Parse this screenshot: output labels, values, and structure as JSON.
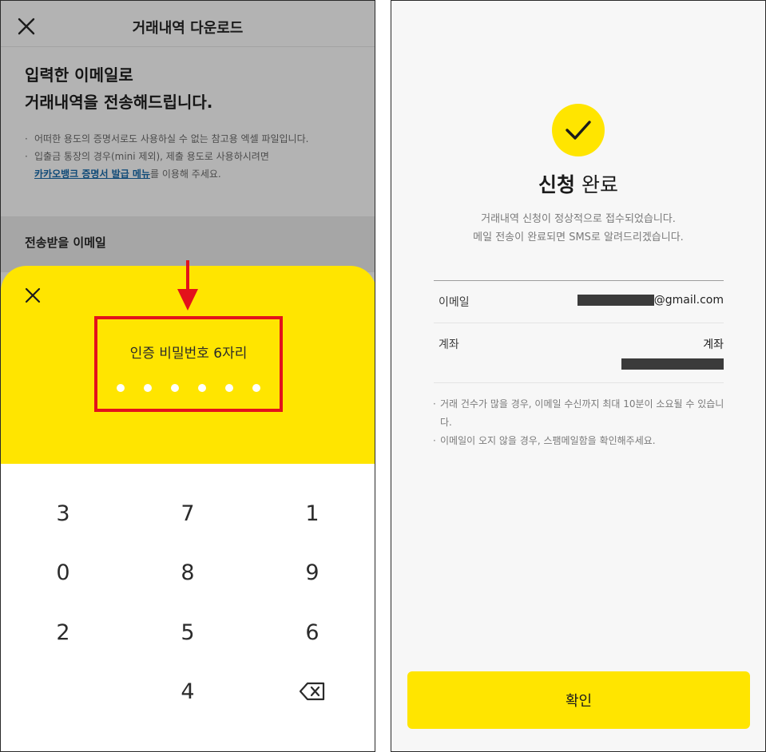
{
  "left": {
    "header": {
      "title": "거래내역 다운로드",
      "close_icon": "close-icon"
    },
    "headline_line1": "입력한 이메일로",
    "headline_line2": "거래내역을 전송해드립니다.",
    "notes": {
      "note1": "어떠한 용도의 증명서로도 사용하실 수 없는 참고용 엑셀 파일입니다.",
      "note2_line1": "입출금 통장의 경우(mini 제외), 제출 용도로 사용하시려면",
      "note2_link": "카카오뱅크 증명서 발급 메뉴",
      "note2_suffix": "를 이용해 주세요."
    },
    "section_title": "전송받을 이메일",
    "sheet": {
      "close_icon": "close-icon",
      "pin_label": "인증 비밀번호 6자리",
      "pin_filled": 6,
      "highlight_color": "#e3121b"
    },
    "keypad": {
      "keys": [
        "3",
        "7",
        "1",
        "0",
        "8",
        "9",
        "2",
        "5",
        "6",
        "4"
      ],
      "backspace_icon": "backspace-icon"
    }
  },
  "right": {
    "status_icon": "check-icon",
    "title_bold": "신청",
    "title_rest": " 완료",
    "desc_line1": "거래내역 신청이 정상적으로 접수되었습니다.",
    "desc_line2": "메일 전송이 완료되면 SMS로 알려드리겠습니다.",
    "email_label": "이메일",
    "email_suffix": "@gmail.com",
    "account_label": "계좌",
    "account_value": "계좌",
    "notes": {
      "note1": "거래 건수가 많을 경우, 이메일 수신까지 최대 10분이 소요될 수 있습니다.",
      "note2": "이메일이 오지 않을 경우, 스팸메일함을 확인해주세요."
    },
    "confirm_label": "확인"
  },
  "colors": {
    "accent_yellow": "#ffe500",
    "link_blue": "#0f4a78",
    "dim_overlay": "#b3b3b3"
  }
}
